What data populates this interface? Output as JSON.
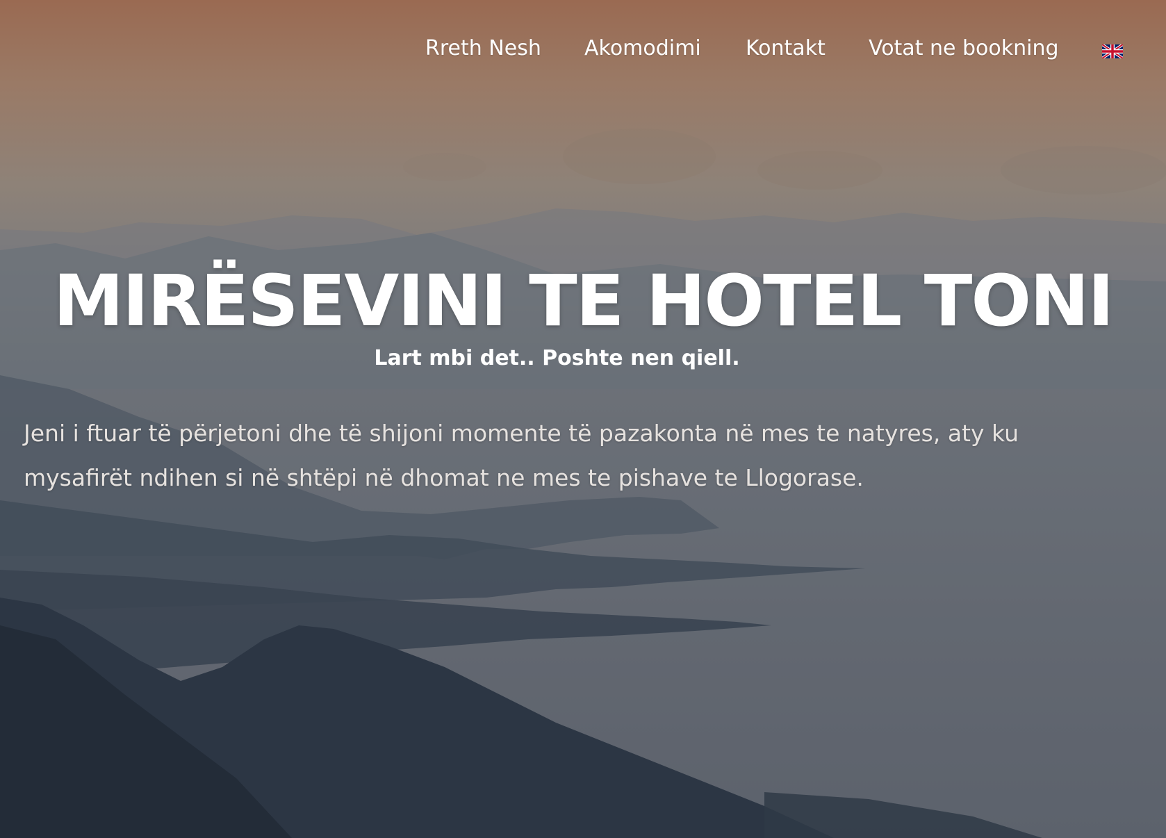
{
  "nav": {
    "items": [
      {
        "label": "Rreth Nesh"
      },
      {
        "label": "Akomodimi"
      },
      {
        "label": "Kontakt"
      },
      {
        "label": "Votat ne bookning"
      }
    ],
    "language_flag": "uk-flag-icon"
  },
  "hero": {
    "title": "MIRËSEVINI TE HOTEL TONI",
    "tagline": "Lart mbi det.. Poshte nen qiell.",
    "intro_line_1": "Jeni i ftuar të përjetoni dhe të shijoni momente të pazakonta në mes te natyres, aty ku",
    "intro_line_2": "mysafirët ndihen si në shtëpi në dhomat ne mes te pishave te Llogorase."
  },
  "colors": {
    "text": "#ffffff",
    "intro_text": "#e6e2df",
    "sky_top": "#9a6a52",
    "sea": "#6d7178",
    "mountains_dark": "#2c3644"
  }
}
